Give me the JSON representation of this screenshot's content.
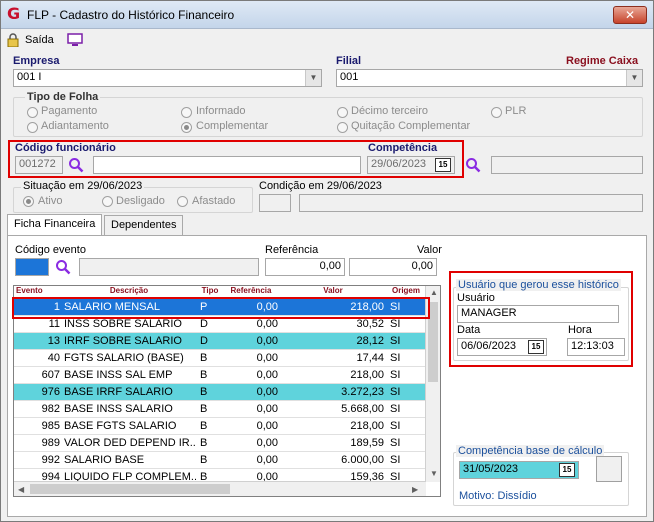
{
  "window": {
    "title": "FLP - Cadastro do Histórico Financeiro",
    "close_label": "✕"
  },
  "toolbar": {
    "exit_label": "Saída"
  },
  "empresa": {
    "label": "Empresa",
    "value": "001 I"
  },
  "filial": {
    "label": "Filial",
    "value": "001"
  },
  "regime": {
    "label": "Regime Caixa"
  },
  "tipo_folha": {
    "title": "Tipo de Folha",
    "options": [
      "Pagamento",
      "Informado",
      "Décimo terceiro",
      "PLR",
      "Adiantamento",
      "Complementar",
      "Quitação Complementar"
    ],
    "selected": "Complementar"
  },
  "funcionario": {
    "label": "Código funcionário",
    "code": "001272",
    "name": ""
  },
  "competencia": {
    "label": "Competência",
    "value": "29/06/2023",
    "extra": ""
  },
  "situacao": {
    "title": "Situação em 29/06/2023",
    "options": [
      "Ativo",
      "Desligado",
      "Afastado"
    ],
    "selected": "Ativo"
  },
  "condicao": {
    "title": "Condição em 29/06/2023"
  },
  "tabs": [
    "Ficha Financeira",
    "Dependentes"
  ],
  "filters": {
    "codigo_evento_label": "Código evento",
    "referencia_label": "Referência",
    "referencia_value": "0,00",
    "valor_label": "Valor",
    "valor_value": "0,00"
  },
  "grid": {
    "headers": [
      "Evento",
      "Descrição",
      "Tipo",
      "Referência",
      "Valor",
      "Origem"
    ],
    "rows": [
      {
        "evento": "1",
        "descricao": "SALARIO MENSAL",
        "tipo": "P",
        "referencia": "0,00",
        "valor": "218,00",
        "origem": "SI",
        "state": "selected"
      },
      {
        "evento": "11",
        "descricao": "INSS SOBRE SALARIO",
        "tipo": "D",
        "referencia": "0,00",
        "valor": "30,52",
        "origem": "SI",
        "state": ""
      },
      {
        "evento": "13",
        "descricao": "IRRF SOBRE SALARIO",
        "tipo": "D",
        "referencia": "0,00",
        "valor": "28,12",
        "origem": "SI",
        "state": "highlight"
      },
      {
        "evento": "40",
        "descricao": "FGTS SALARIO (BASE)",
        "tipo": "B",
        "referencia": "0,00",
        "valor": "17,44",
        "origem": "SI",
        "state": ""
      },
      {
        "evento": "607",
        "descricao": "BASE INSS SAL EMP",
        "tipo": "B",
        "referencia": "0,00",
        "valor": "218,00",
        "origem": "SI",
        "state": ""
      },
      {
        "evento": "976",
        "descricao": "BASE IRRF SALARIO",
        "tipo": "B",
        "referencia": "0,00",
        "valor": "3.272,23",
        "origem": "SI",
        "state": "highlight"
      },
      {
        "evento": "982",
        "descricao": "BASE INSS SALARIO",
        "tipo": "B",
        "referencia": "0,00",
        "valor": "5.668,00",
        "origem": "SI",
        "state": ""
      },
      {
        "evento": "985",
        "descricao": "BASE FGTS SALARIO",
        "tipo": "B",
        "referencia": "0,00",
        "valor": "218,00",
        "origem": "SI",
        "state": ""
      },
      {
        "evento": "989",
        "descricao": "VALOR DED DEPEND IR...",
        "tipo": "B",
        "referencia": "0,00",
        "valor": "189,59",
        "origem": "SI",
        "state": ""
      },
      {
        "evento": "992",
        "descricao": "SALARIO BASE",
        "tipo": "B",
        "referencia": "0,00",
        "valor": "6.000,00",
        "origem": "SI",
        "state": ""
      },
      {
        "evento": "994",
        "descricao": "LIQUIDO FLP COMPLEM...",
        "tipo": "B",
        "referencia": "0,00",
        "valor": "159,36",
        "origem": "SI",
        "state": ""
      }
    ]
  },
  "usuario_box": {
    "title": "Usuário que gerou esse histórico",
    "usuario_label": "Usuário",
    "usuario_value": "MANAGER",
    "data_label": "Data",
    "data_value": "06/06/2023",
    "hora_label": "Hora",
    "hora_value": "12:13:03"
  },
  "competencia_base": {
    "title": "Competência base de cálculo",
    "value": "31/05/2023",
    "motivo": "Motivo: Dissídio"
  },
  "calendar_btn_label": "15",
  "colors": {
    "selected_row": "#1c75d8",
    "highlight_row": "#5fd3dc",
    "annotation": "#e00000"
  }
}
